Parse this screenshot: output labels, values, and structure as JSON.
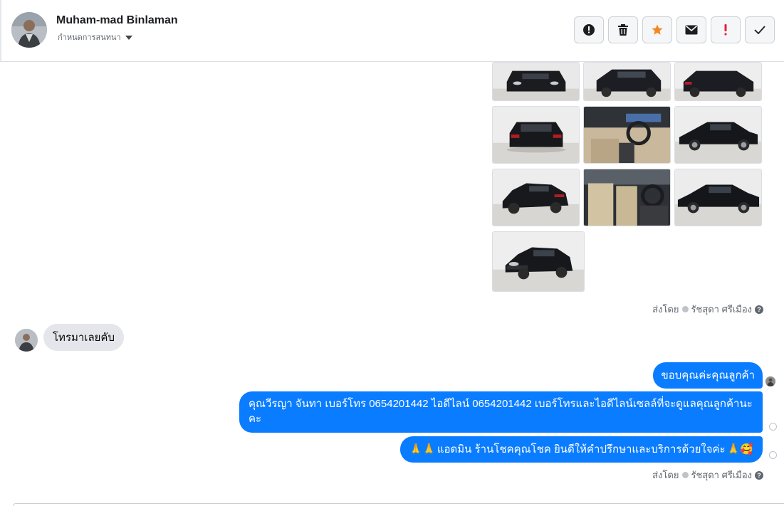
{
  "header": {
    "contact_name": "Muham-mad Binlaman",
    "settings_label": "กำหนดการสนทนา"
  },
  "toolbar": {
    "buttons": [
      {
        "name": "report-button",
        "icon": "alert-circle-icon",
        "color": "#1c1e21"
      },
      {
        "name": "delete-button",
        "icon": "trash-icon",
        "color": "#1c1e21"
      },
      {
        "name": "star-button",
        "icon": "star-icon",
        "color": "#f5871f"
      },
      {
        "name": "mark-unread-button",
        "icon": "envelope-icon",
        "color": "#1c1e21"
      },
      {
        "name": "follow-up-button",
        "icon": "exclamation-icon",
        "color": "#e41e3f"
      },
      {
        "name": "done-button",
        "icon": "check-icon",
        "color": "#1c1e21"
      }
    ]
  },
  "photos": {
    "count": 10,
    "items": [
      "car-front",
      "car-front-three-quarter",
      "car-rear-three-quarter",
      "car-rear",
      "car-dashboard",
      "car-side-right",
      "car-rear-left",
      "car-interior-seats",
      "car-side-left",
      "car-front-left"
    ]
  },
  "sent_by_1": {
    "prefix": "ส่งโดย",
    "agent": "รัชสุดา ศรีเมือง",
    "help": "?"
  },
  "incoming": {
    "text": "โทรมาเลยคับ"
  },
  "outgoing": [
    {
      "text": "ขอบคุณค่ะคุณลูกค้า"
    },
    {
      "text": "คุณวีรญา จันทา      เบอร์โทร 0654201442  ไอดีไลน์ 0654201442   เบอร์โทรและไอดีไลน์เซลล์ที่จะดูแลคุณลูกค้านะคะ"
    },
    {
      "emoji_prefix": "🙏🙏",
      "text": "แอดมิน ร้านโชคคุณโชค ยินดีให้คำปรึกษาและบริการด้วยใจค่ะ",
      "emoji_suffix": "🙏🥰"
    }
  ],
  "sent_by_2": {
    "prefix": "ส่งโดย",
    "agent": "รัชสุดา ศรีเมือง",
    "help": "?"
  },
  "colors": {
    "brand_blue": "#0a7cff",
    "incoming_bubble": "#e4e6eb",
    "star_orange": "#f5871f",
    "alert_red": "#e41e3f"
  }
}
